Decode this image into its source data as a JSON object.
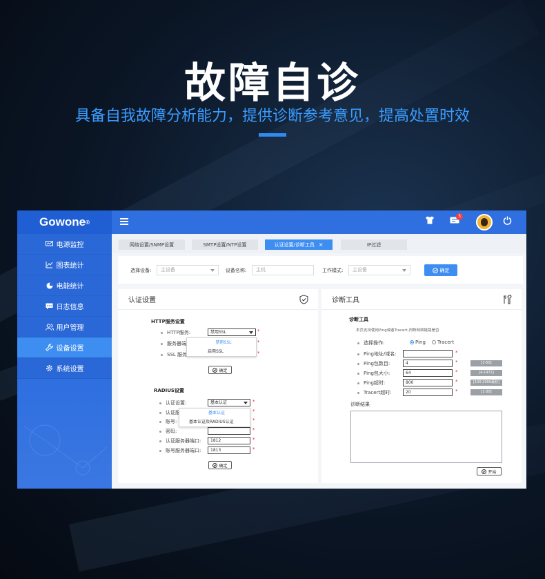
{
  "hero": {
    "title": "故障自诊",
    "subtitle": "具备自我故障分析能力，提供诊断参考意见，提高处置时效"
  },
  "colors": {
    "primary": "#2f6fe0",
    "accent": "#3e8ef2",
    "subtitle": "#3a9cff"
  },
  "app": {
    "logo": "Gowone",
    "logo_mark": "®",
    "sidebar": [
      {
        "label": "电源监控",
        "icon": "monitor-icon"
      },
      {
        "label": "图表统计",
        "icon": "chart-icon"
      },
      {
        "label": "电能统计",
        "icon": "pie-icon"
      },
      {
        "label": "日志信息",
        "icon": "message-icon"
      },
      {
        "label": "用户管理",
        "icon": "users-icon"
      },
      {
        "label": "设备设置",
        "icon": "wrench-icon",
        "active": true
      },
      {
        "label": "系统设置",
        "icon": "gear-icon"
      }
    ],
    "topbar": {
      "notification_count": "3"
    },
    "tabs": [
      {
        "label": "网络设置/SNMP设置"
      },
      {
        "label": "SMTP设置/NTP设置"
      },
      {
        "label": "认证设置/诊断工具",
        "active": true,
        "close": "×"
      },
      {
        "label": "IP过滤"
      }
    ],
    "filter": {
      "device_label": "选择设备:",
      "device_value": "主设备",
      "name_label": "设备名称:",
      "name_value": "主机",
      "mode_label": "工作模式:",
      "mode_value": "主设备",
      "ok_label": "确定"
    },
    "auth_panel": {
      "title": "认证设置",
      "http_title": "HTTP服务设置",
      "http_fields": [
        {
          "label": "HTTP服务:",
          "value": "禁用SSL"
        },
        {
          "label": "服务器端"
        },
        {
          "label": "SSL 服务"
        }
      ],
      "http_dropdown": [
        "禁用SSL",
        "启用SSL"
      ],
      "http_confirm": "确定",
      "radius_title": "RADIUS设置",
      "radius_fields": [
        {
          "label": "认证设置:",
          "value": "基本认证"
        },
        {
          "label": "认证服"
        },
        {
          "label": "账号:"
        },
        {
          "label": "密码:"
        },
        {
          "label": "认证服务器端口:",
          "value": "1812"
        },
        {
          "label": "账号服务器端口:",
          "value": "1813"
        }
      ],
      "radius_dropdown": [
        "基本认证",
        "基本认证及RADIUS认证"
      ],
      "radius_confirm": "确定"
    },
    "diag_panel": {
      "title": "诊断工具",
      "section_title": "诊断工具",
      "note": "本页支持使用Ping或者Tracert,判断网络链路是否",
      "op_label": "选择操作:",
      "op_ping": "Ping",
      "op_tracert": "Tracert",
      "fields": [
        {
          "label": "Ping地址/域名:",
          "value": ""
        },
        {
          "label": "Ping包数目:",
          "value": "4",
          "hint": "[1-50]"
        },
        {
          "label": "Ping包大小:",
          "value": "64",
          "hint": "[4-1472]"
        },
        {
          "label": "Ping超时:",
          "value": "800",
          "hint": "[100-2000毫秒]"
        },
        {
          "label": "Tracert超时:",
          "value": "20",
          "hint": "[1-30]"
        }
      ],
      "result_label": "诊断结果",
      "start_label": "开始"
    }
  }
}
